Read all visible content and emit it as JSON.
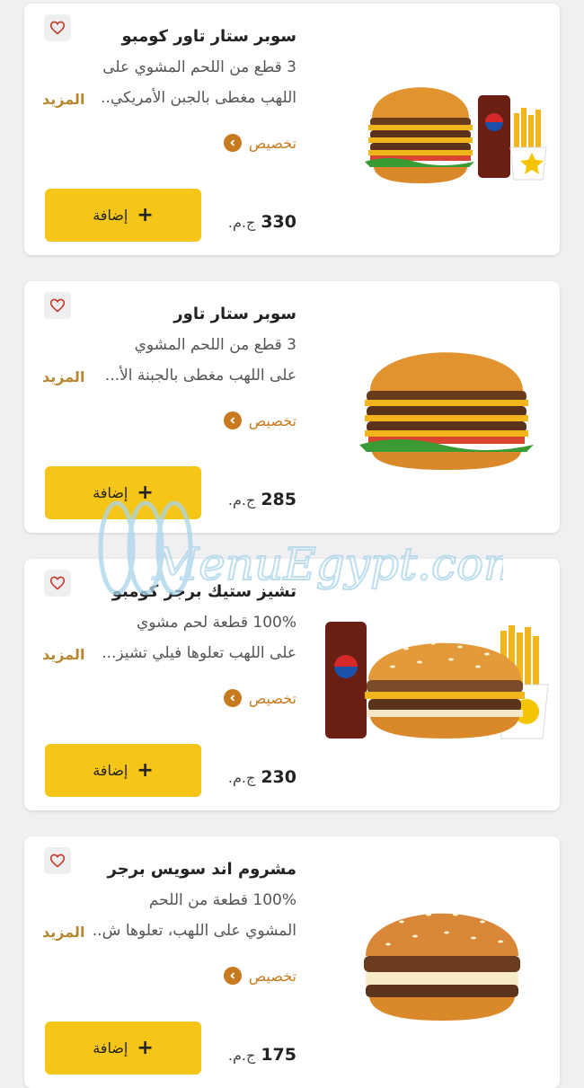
{
  "currency": "ج.م.",
  "add_label": "إضافة",
  "more_label": "المزيد",
  "customize_label": "تخصيص",
  "watermark_text": "MenuEgypt.com",
  "items": [
    {
      "title": "سوبر ستار تاور كومبو",
      "desc1": "3 قطع من اللحم المشوي على",
      "desc2": "اللهب مغطى بالجبن الأمريكي..",
      "price": "330"
    },
    {
      "title": "سوبر ستار تاور",
      "desc1": "3 قطع من اللحم المشوي",
      "desc2": "على اللهب مغطى بالجبنة الأ...",
      "price": "285"
    },
    {
      "title": "تشيز ستيك برجر كومبو",
      "desc1": "100% قطعة لحم مشوي",
      "desc2": "على اللهب تعلوها فيلي تشيز...",
      "price": "230"
    },
    {
      "title": "مشروم اند سويس برجر",
      "desc1": "100% قطعة من اللحم",
      "desc2": "المشوي على اللهب، تعلوها ش..",
      "price": "175"
    }
  ]
}
